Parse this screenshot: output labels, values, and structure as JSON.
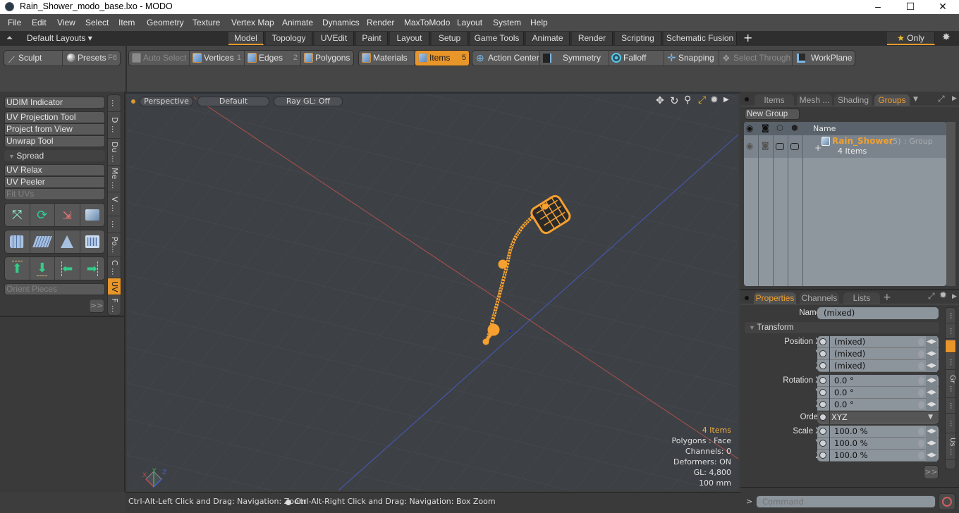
{
  "window": {
    "title": "Rain_Shower_modo_base.lxo - MODO",
    "minimize": "–",
    "maximize": "☐",
    "close": "✕"
  },
  "menubar": {
    "items": [
      "File",
      "Edit",
      "View",
      "Select",
      "Item",
      "Geometry",
      "Texture",
      "Vertex Map",
      "Animate",
      "Dynamics",
      "Render",
      "MaxToModo",
      "Layout",
      "System",
      "Help"
    ]
  },
  "layoutbar": {
    "layouts_label": "Default Layouts ▾",
    "tabs": [
      "Model",
      "Topology",
      "UVEdit",
      "Paint",
      "Layout",
      "Setup",
      "Game Tools",
      "Animate",
      "Render",
      "Scripting",
      "Schematic Fusion"
    ],
    "active_tab": "Model",
    "add_tab": "+",
    "only_label": "★ Only",
    "settings_icon": "gear-icon"
  },
  "toolbar": {
    "sculpt": "Sculpt",
    "presets": "Presets",
    "presets_key": "F6",
    "auto_select": "Auto Select",
    "vertices": "Vertices",
    "vertices_key": "1",
    "edges": "Edges",
    "edges_key": "2",
    "polygons": "Polygons",
    "materials": "Materials",
    "items": "Items",
    "items_key": "5",
    "action_center": "Action Center",
    "symmetry": "Symmetry",
    "falloff": "Falloff",
    "snapping": "Snapping",
    "select_through": "Select Through",
    "workplane": "WorkPlane"
  },
  "leftpanel": {
    "udim": "UDIM Indicator",
    "uv_projection": "UV Projection Tool",
    "project_from_view": "Project from View",
    "unwrap": "Unwrap Tool",
    "spread": "Spread",
    "uv_relax": "UV Relax",
    "uv_peeler": "UV Peeler",
    "fit_uvs": "Fit UVs",
    "orient_pieces": "Orient Pieces",
    "more": ">>",
    "vtabs": [
      "...",
      "D ...",
      "Du ...",
      "Me ...",
      "V ...",
      "...",
      "Po...",
      "C ...",
      "UV",
      "F ..."
    ],
    "active_vtab": "UV"
  },
  "viewport": {
    "view": "Perspective",
    "shading": "Default",
    "raygl": "Ray GL: Off",
    "info": {
      "items": "4 Items",
      "polygons": "Polygons : Face",
      "channels": "Channels: 0",
      "deformers": "Deformers: ON",
      "gl": "GL: 4,800",
      "scale": "100 mm"
    },
    "axis_x": "X",
    "axis_y": "Y",
    "axis_z": "Z"
  },
  "statusbar": {
    "left_hint": "Ctrl-Alt-Left Click and Drag: Navigation: Zoom",
    "right_hint": "Ctrl-Alt-Right Click and Drag: Navigation: Box Zoom"
  },
  "groups_panel": {
    "tabs": [
      "Items",
      "Mesh ...",
      "Shading",
      "Groups"
    ],
    "active_tab": "Groups",
    "new_group": "New Group",
    "col_name": "Name",
    "group": {
      "name": "Rain_Shower",
      "count": "(5)",
      "type": ": Group",
      "subtitle": "4 Items"
    }
  },
  "properties_panel": {
    "tabs": [
      "Properties",
      "Channels",
      "Lists"
    ],
    "active_tab": "Properties",
    "add_tab": "+",
    "name_label": "Name",
    "name_value": "(mixed)",
    "transform_label": "Transform",
    "position": {
      "label_x": "Position X",
      "label_y": "Y",
      "label_z": "Z",
      "x": "(mixed)",
      "y": "(mixed)",
      "z": "(mixed)"
    },
    "rotation": {
      "label_x": "Rotation X",
      "label_y": "Y",
      "label_z": "Z",
      "x": "0.0 °",
      "y": "0.0 °",
      "z": "0.0 °"
    },
    "order": {
      "label": "Order",
      "value": "XYZ"
    },
    "scale": {
      "label_x": "Scale X",
      "label_y": "Y",
      "label_z": "Z",
      "x": "100.0 %",
      "y": "100.0 %",
      "z": "100.0 %"
    },
    "more": ">>",
    "vtabs": [
      "...",
      "...",
      "",
      "...",
      "Gr ...",
      "...",
      "...",
      "Us ..."
    ]
  },
  "command": {
    "prompt": ">",
    "placeholder": "Command"
  },
  "colors": {
    "accent": "#e8952a",
    "viewport_bg": "#3d4146",
    "x_axis": "#c0504a",
    "z_axis": "#4a5ec0",
    "selection": "#f5a030"
  }
}
